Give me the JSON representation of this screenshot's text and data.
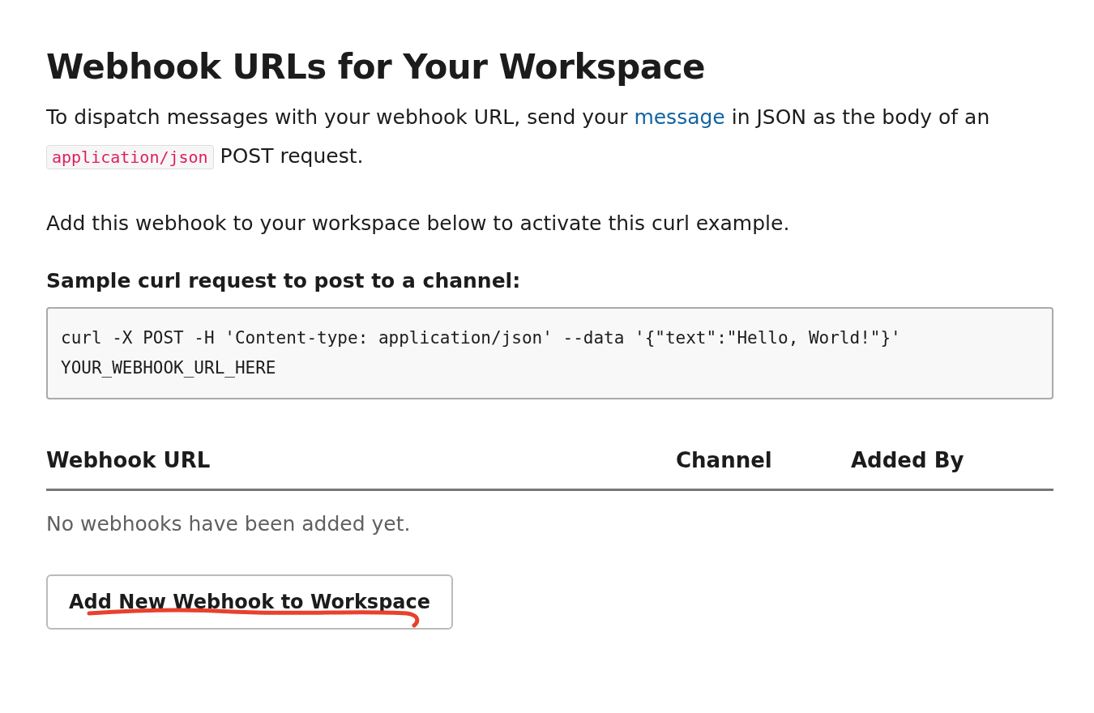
{
  "title": "Webhook URLs for Your Workspace",
  "intro": [
    {
      "kind": "text",
      "text": "To dispatch messages with your webhook URL, send your "
    },
    {
      "kind": "link",
      "text": "message"
    },
    {
      "kind": "text",
      "text": " in JSON as the body of an "
    },
    {
      "kind": "code",
      "text": "application/json"
    },
    {
      "kind": "text",
      "text": " POST request."
    }
  ],
  "activation_note": "Add this webhook to your workspace below to activate this curl example.",
  "sample_heading": "Sample curl request to post to a channel:",
  "sample_code": "curl -X POST -H 'Content-type: application/json' --data '{\"text\":\"Hello, World!\"}' YOUR_WEBHOOK_URL_HERE",
  "table": {
    "columns": [
      "Webhook URL",
      "Channel",
      "Added By"
    ],
    "empty_message": "No webhooks have been added yet."
  },
  "button": "Add New Webhook to Workspace"
}
